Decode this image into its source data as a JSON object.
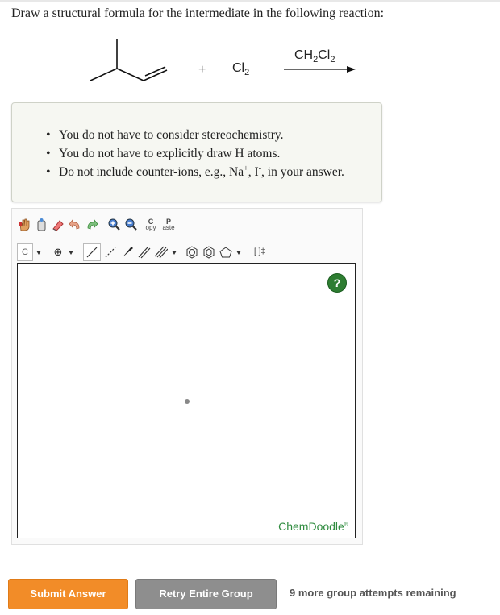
{
  "question": "Draw a structural formula for the intermediate in the following reaction:",
  "reaction": {
    "plus": "+",
    "reagent_prefix": "Cl",
    "reagent_sub": "2",
    "solvent_a": "CH",
    "solvent_sub1": "2",
    "solvent_b": "Cl",
    "solvent_sub2": "2"
  },
  "notes": {
    "line1": "You do not have to consider stereochemistry.",
    "line2": "You do not have to explicitly draw H atoms.",
    "line3_prefix": "Do not include counter-ions, e.g., Na",
    "line3_sup1": "+",
    "line3_mid": ", I",
    "line3_sup2": "-",
    "line3_suffix": ", in your answer."
  },
  "toolbar": {
    "copy_top": "C",
    "copy_bottom": "opy",
    "paste_top": "P",
    "paste_bottom": "aste",
    "atom_label": "C",
    "charge_symbol": "⊕",
    "bracket_label": "[ ]‡"
  },
  "editor": {
    "help_label": "?",
    "brand": "ChemDoodle",
    "brand_mark": "®"
  },
  "buttons": {
    "submit": "Submit Answer",
    "retry": "Retry Entire Group"
  },
  "attempts": "9 more group attempts remaining",
  "colors": {
    "submit": "#f28c28",
    "retry": "#8e8e8e",
    "help": "#2e7d32",
    "brand": "#2e8b3e"
  }
}
